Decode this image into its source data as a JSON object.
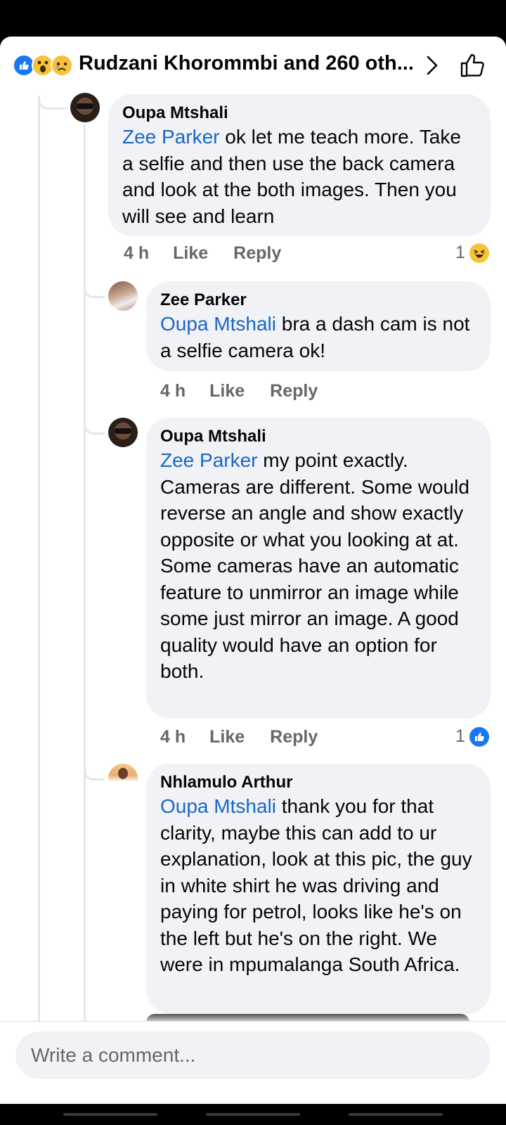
{
  "header": {
    "title": "Rudzani Khorommbi and 260 oth...",
    "reactions": [
      "like-reaction-icon",
      "wow-reaction-icon",
      "sad-reaction-icon"
    ]
  },
  "comments": [
    {
      "author": "Oupa Mtshali",
      "mention": "Zee Parker",
      "text": " ok let me teach more. Take a selfie and then use the back camera and look at the both images. Then you will see and learn",
      "time": "4 h",
      "like": "Like",
      "reply": "Reply",
      "reaction_count": "1",
      "reaction": "haha-reaction-icon"
    },
    {
      "author": "Zee Parker",
      "mention": "Oupa Mtshali",
      "text": " bra a dash cam is not a selfie camera ok!",
      "time": "4 h",
      "like": "Like",
      "reply": "Reply"
    },
    {
      "author": "Oupa Mtshali",
      "mention": "Zee Parker",
      "text": " my point exactly. Cameras are different. Some would reverse an angle and show exactly opposite or what you looking at at. Some cameras have an automatic feature to unmirror an image while some just mirror an image. A good quality would have an option for both.",
      "time": "4 h",
      "like": "Like",
      "reply": "Reply",
      "reaction_count": "1",
      "reaction": "like-reaction-icon"
    },
    {
      "author": "Nhlamulo Arthur",
      "mention": "Oupa Mtshali",
      "text": " thank you for that clarity, maybe this can add to ur explanation, look at this pic, the guy in white shirt he was driving and paying for petrol, looks like he's on the left but he's on the right. We were in mpumalanga South Africa."
    }
  ],
  "composer": {
    "placeholder": "Write a comment..."
  },
  "colors": {
    "mention": "#1a67c8",
    "bubble": "#f0f2f5",
    "meta": "#65676b",
    "like_blue": "#1877f2"
  }
}
